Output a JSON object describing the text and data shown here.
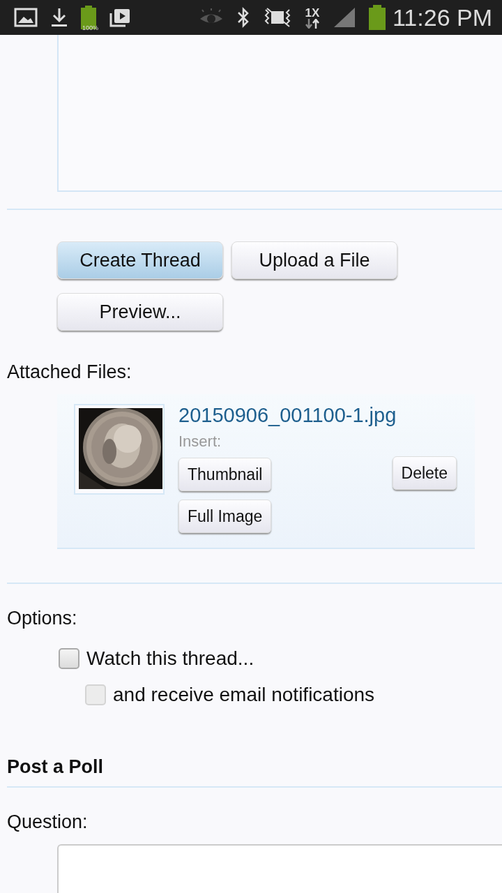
{
  "status_bar": {
    "battery_small_label": "100%",
    "network_label": "1X",
    "time": "11:26 PM"
  },
  "buttons": [
    {
      "label": "Create Thread",
      "kind": "primary"
    },
    {
      "label": "Upload a File",
      "kind": "normal"
    },
    {
      "label": "Preview...",
      "kind": "normal"
    }
  ],
  "attached_files": {
    "label": "Attached Files:",
    "files": [
      {
        "name": "20150906_001100-1.jpg",
        "insert_label": "Insert:",
        "insert_buttons": [
          "Thumbnail",
          "Full Image"
        ],
        "delete_button": "Delete"
      }
    ]
  },
  "options": {
    "label": "Options:",
    "checkboxes": [
      {
        "label": "Watch this thread...",
        "checked": false,
        "disabled": false
      },
      {
        "label": "and receive email notifications",
        "checked": false,
        "disabled": true
      }
    ]
  },
  "poll": {
    "heading": "Post a Poll",
    "question_label": "Question:"
  }
}
